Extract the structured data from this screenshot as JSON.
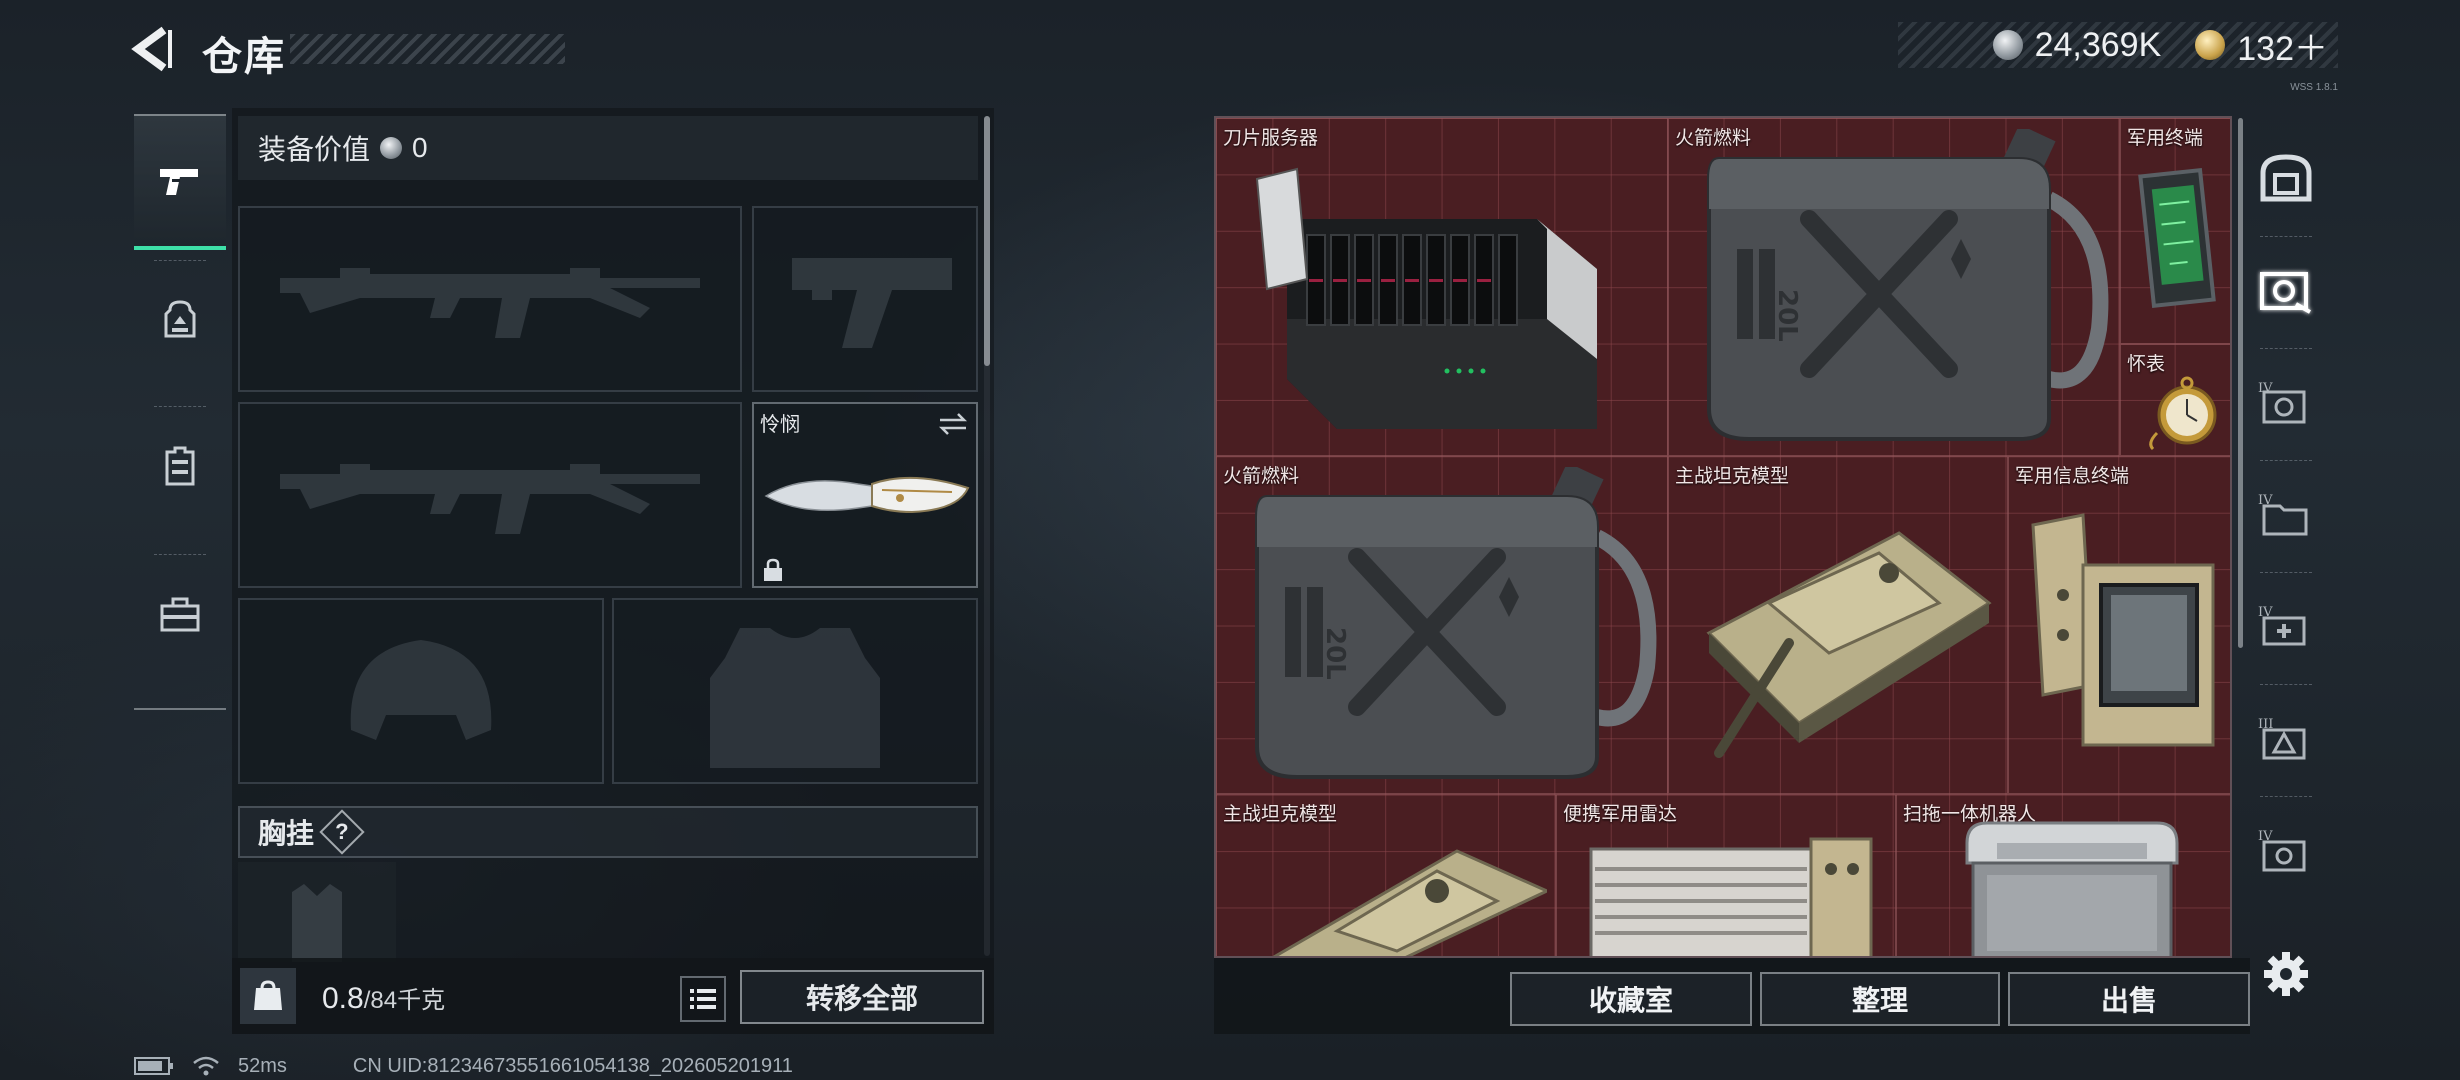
{
  "header": {
    "title": "仓库",
    "currency": [
      {
        "icon": "silver-coin-icon",
        "value": "24,369K"
      },
      {
        "icon": "gold-coin-icon",
        "value": "132＋"
      }
    ],
    "version_tag": "WSS 1.8.1"
  },
  "left_nav": {
    "items": [
      {
        "icon": "pistol-icon",
        "active": true
      },
      {
        "icon": "backpack-icon",
        "active": false
      },
      {
        "icon": "vest-icon",
        "active": false
      },
      {
        "icon": "toolbox-icon",
        "active": false
      }
    ]
  },
  "loadout": {
    "equip_value_label": "装备价值",
    "equip_value": "0",
    "slots": [
      {
        "id": "primary-1",
        "icon": "assault-rifle-icon",
        "label": ""
      },
      {
        "id": "pistol",
        "icon": "pistol-silhouette-icon",
        "label": ""
      },
      {
        "id": "primary-2",
        "icon": "assault-rifle-icon",
        "label": ""
      },
      {
        "id": "melee",
        "icon": "knife-icon",
        "label": "怜悯"
      },
      {
        "id": "helmet",
        "icon": "helmet-icon",
        "label": ""
      },
      {
        "id": "armor",
        "icon": "body-armor-icon",
        "label": ""
      }
    ],
    "chest_label": "胸挂",
    "chest_help": "?",
    "weight_current": "0.8",
    "weight_max": "/84千克",
    "transfer_all": "转移全部"
  },
  "storage": {
    "items": [
      {
        "name": "刀片服务器",
        "icon": "blade-server-icon"
      },
      {
        "name": "火箭燃料",
        "icon": "fuel-can-icon"
      },
      {
        "name": "军用终端",
        "icon": "military-terminal-icon"
      },
      {
        "name": "怀表",
        "icon": "pocket-watch-icon"
      },
      {
        "name": "火箭燃料",
        "icon": "fuel-can-icon"
      },
      {
        "name": "主战坦克模型",
        "icon": "tank-model-icon"
      },
      {
        "name": "军用信息终端",
        "icon": "info-terminal-icon"
      },
      {
        "name": "主战坦克模型",
        "icon": "tank-model-icon"
      },
      {
        "name": "便携军用雷达",
        "icon": "radar-icon"
      },
      {
        "name": "扫拖一体机器人",
        "icon": "robot-vacuum-icon"
      }
    ],
    "buttons": {
      "collection": "收藏室",
      "organize": "整理",
      "sell": "出售"
    },
    "colors": {
      "grid_bg": "#4a1e22",
      "accent": "#3ee0a8"
    }
  },
  "right_tabs": {
    "items": [
      {
        "icon": "vault-icon",
        "level": ""
      },
      {
        "icon": "camera-case-icon",
        "level": ""
      },
      {
        "icon": "safe-camera-icon",
        "level": "IV"
      },
      {
        "icon": "folder-icon",
        "level": "IV"
      },
      {
        "icon": "medkit-icon",
        "level": "IV"
      },
      {
        "icon": "warning-case-icon",
        "level": "III"
      },
      {
        "icon": "key-case-icon",
        "level": "IV"
      }
    ]
  },
  "status_bar": {
    "ping": "52ms",
    "uid": "CN UID:81234673551661054138_202605201911"
  }
}
